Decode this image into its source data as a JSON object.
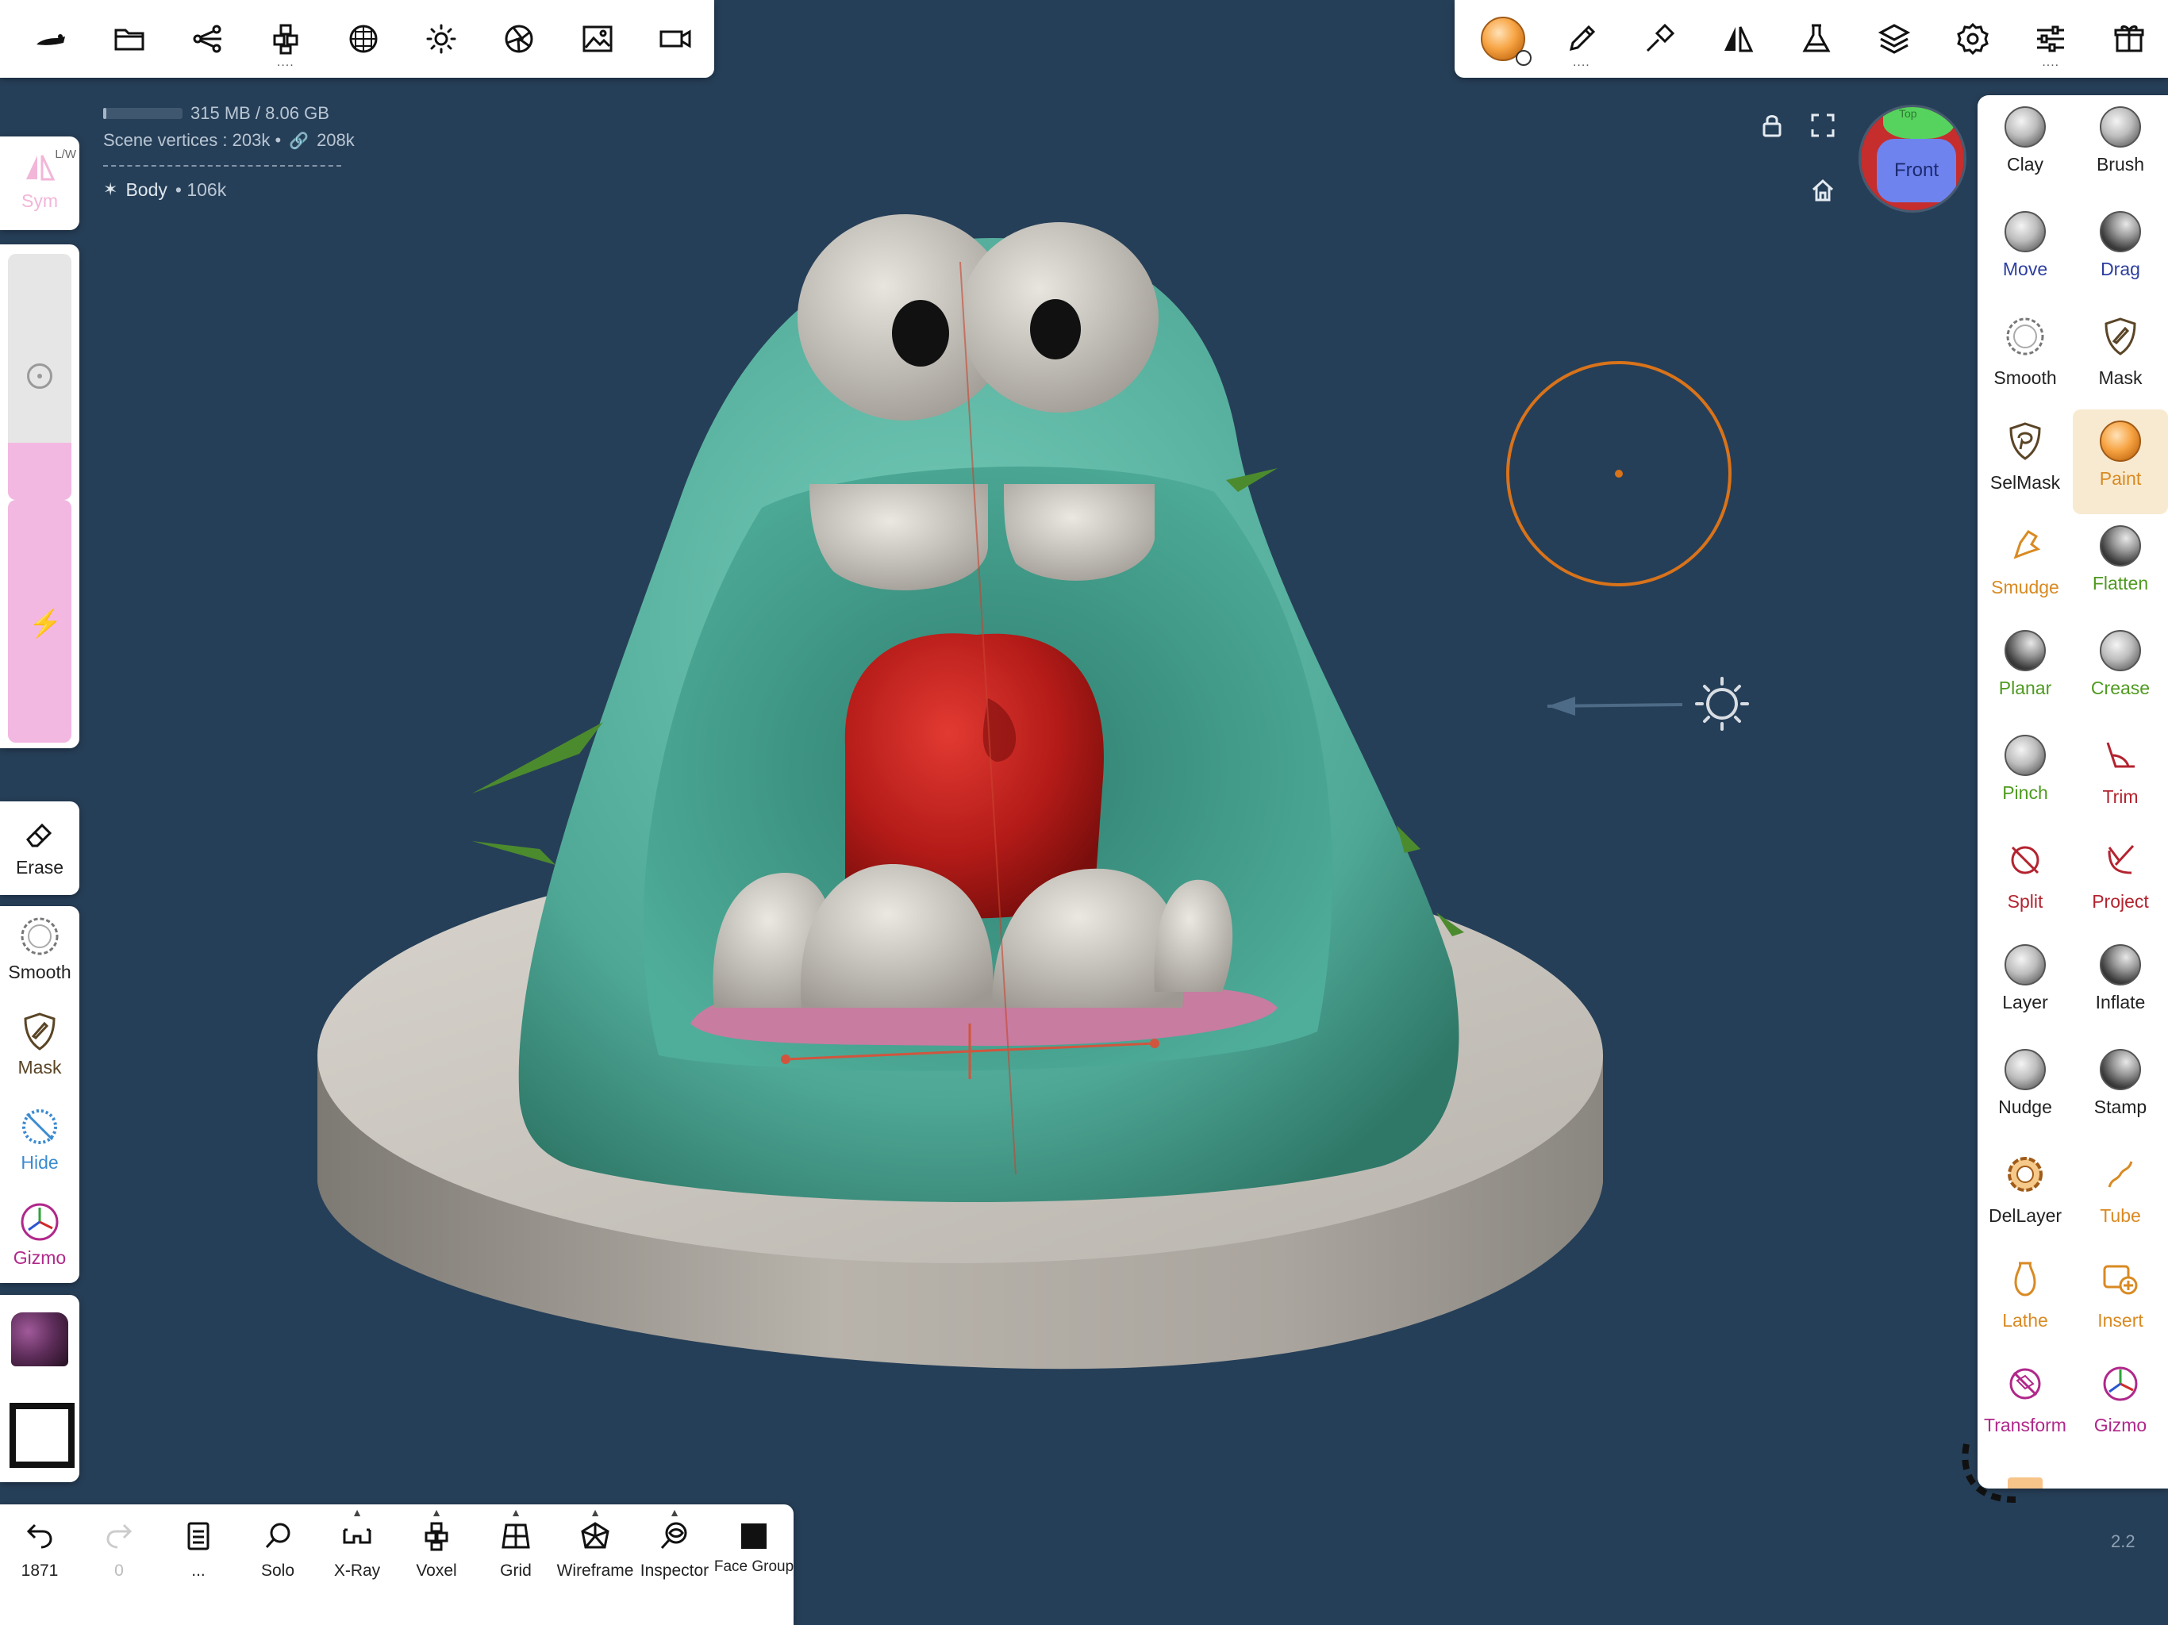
{
  "stats": {
    "memory": "315 MB / 8.06 GB",
    "memory_fraction": 0.04,
    "vertices_label": "Scene vertices : 203k •",
    "vertices_linked": "208k",
    "object_name": "Body",
    "object_count": "• 106k"
  },
  "top_left_toolbar": {
    "icons": [
      "nomad-logo-icon",
      "folder-icon",
      "scene-graph-icon",
      "primitives-icon",
      "background-icon",
      "light-icon",
      "shading-icon",
      "image-icon",
      "video-icon"
    ]
  },
  "top_right_toolbar": {
    "icons": [
      "material-icon",
      "stroke-icon",
      "tool-settings-icon",
      "symmetry-icon",
      "lab-icon",
      "layers-icon",
      "settings-icon",
      "sliders-icon",
      "gift-icon"
    ]
  },
  "left": {
    "sym_label": "Sym",
    "sym_sub": "L/W",
    "tools": [
      {
        "name": "erase",
        "label": "Erase"
      },
      {
        "name": "smooth",
        "label": "Smooth"
      },
      {
        "name": "mask",
        "label": "Mask"
      },
      {
        "name": "hide",
        "label": "Hide"
      },
      {
        "name": "gizmo",
        "label": "Gizmo"
      }
    ]
  },
  "viewport": {
    "orient_face": "Front",
    "orient_top": "Top"
  },
  "bottom_bar": [
    {
      "name": "undo",
      "label": "1871"
    },
    {
      "name": "redo",
      "label": "0"
    },
    {
      "name": "menu",
      "label": "..."
    },
    {
      "name": "solo",
      "label": "Solo"
    },
    {
      "name": "xray",
      "label": "X-Ray"
    },
    {
      "name": "voxel",
      "label": "Voxel"
    },
    {
      "name": "grid",
      "label": "Grid"
    },
    {
      "name": "wireframe",
      "label": "Wireframe"
    },
    {
      "name": "inspector",
      "label": "Inspector"
    },
    {
      "name": "face-group",
      "label": "Face Group"
    }
  ],
  "tools": [
    {
      "label": "Clay",
      "color": "#222222"
    },
    {
      "label": "Brush",
      "color": "#222222"
    },
    {
      "label": "Move",
      "color": "#2d3ea0"
    },
    {
      "label": "Drag",
      "color": "#2d3ea0"
    },
    {
      "label": "Smooth",
      "color": "#222222"
    },
    {
      "label": "Mask",
      "color": "#222222"
    },
    {
      "label": "SelMask",
      "color": "#222222"
    },
    {
      "label": "Paint",
      "color": "#d98a22"
    },
    {
      "label": "Smudge",
      "color": "#d98a22"
    },
    {
      "label": "Flatten",
      "color": "#4e9a1f"
    },
    {
      "label": "Planar",
      "color": "#4e9a1f"
    },
    {
      "label": "Crease",
      "color": "#4e9a1f"
    },
    {
      "label": "Pinch",
      "color": "#4e9a1f"
    },
    {
      "label": "Trim",
      "color": "#b3232f"
    },
    {
      "label": "Split",
      "color": "#b3232f"
    },
    {
      "label": "Project",
      "color": "#b3232f"
    },
    {
      "label": "Layer",
      "color": "#222222"
    },
    {
      "label": "Inflate",
      "color": "#222222"
    },
    {
      "label": "Nudge",
      "color": "#222222"
    },
    {
      "label": "Stamp",
      "color": "#222222"
    },
    {
      "label": "DelLayer",
      "color": "#222222"
    },
    {
      "label": "Tube",
      "color": "#d98a22"
    },
    {
      "label": "Lathe",
      "color": "#d98a22"
    },
    {
      "label": "Insert",
      "color": "#d98a22"
    },
    {
      "label": "Transform",
      "color": "#b0288a"
    },
    {
      "label": "Gizmo",
      "color": "#b0288a"
    }
  ],
  "version": "2.2",
  "colors": {
    "viewport_bg": "#263f58",
    "accent": "#f2a33a",
    "body_teal": "#5fb8a5",
    "tongue_red": "#c0201c",
    "brush_ring": "#d9731a"
  }
}
